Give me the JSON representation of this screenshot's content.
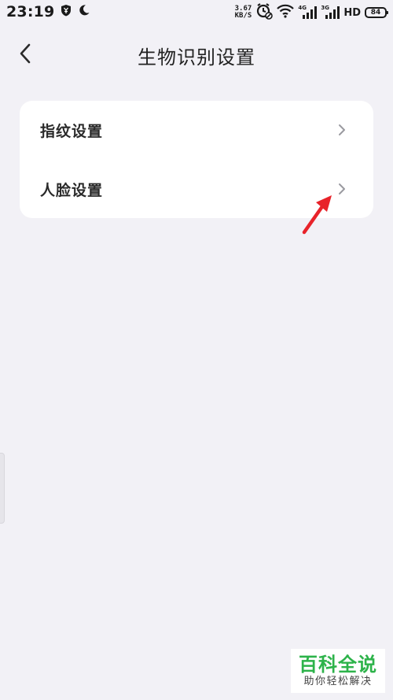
{
  "status_bar": {
    "time": "23:19",
    "net_speed_value": "3.67",
    "net_speed_unit": "KB/S",
    "sim1_tag": "4G",
    "sim2_tag": "3G",
    "hd_label": "HD",
    "battery_level": "84"
  },
  "header": {
    "title": "生物识别设置"
  },
  "settings_list": {
    "items": [
      {
        "label": "指纹设置"
      },
      {
        "label": "人脸设置"
      }
    ]
  },
  "watermark": {
    "main": "百科全说",
    "sub": "助你轻松解决"
  },
  "colors": {
    "background": "#f2f1f6",
    "card": "#ffffff",
    "annotation_arrow": "#e8232a",
    "watermark_green": "#2db34a"
  },
  "icons": {
    "back": "chevron-left-icon",
    "row_chevron": "chevron-right-icon",
    "annotation": "red-arrow-icon"
  }
}
